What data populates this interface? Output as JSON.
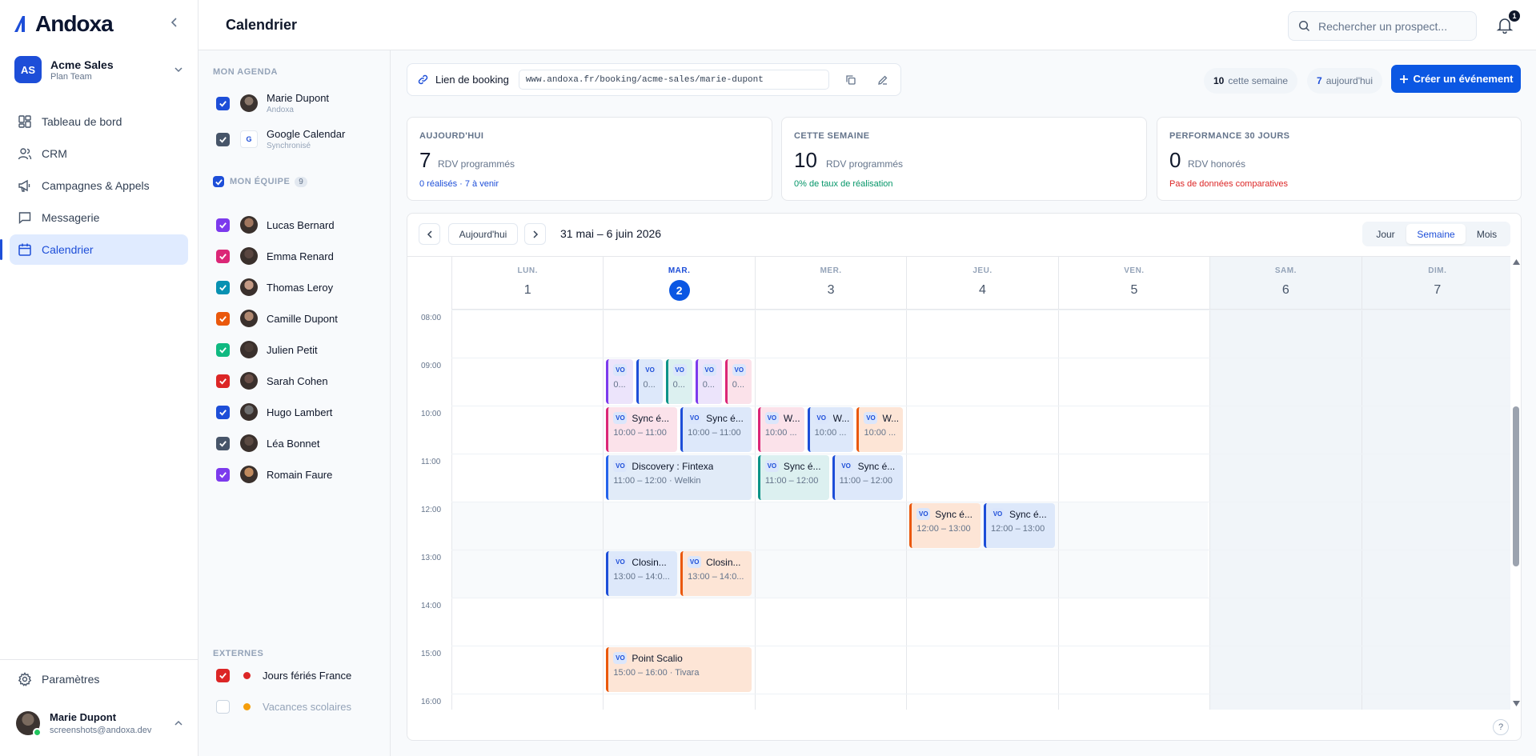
{
  "app": {
    "brand": "Andoxa",
    "workspace": {
      "initials": "AS",
      "name": "Acme Sales",
      "plan": "Plan Team"
    },
    "nav": [
      {
        "label": "Tableau de bord",
        "icon": "dashboard-icon"
      },
      {
        "label": "CRM",
        "icon": "users-icon"
      },
      {
        "label": "Campagnes & Appels",
        "icon": "megaphone-icon"
      },
      {
        "label": "Messagerie",
        "icon": "chat-icon"
      },
      {
        "label": "Calendrier",
        "icon": "calendar-icon",
        "active": true
      }
    ],
    "settings_label": "Paramètres",
    "user": {
      "name": "Marie Dupont",
      "email": "screenshots@andoxa.dev"
    }
  },
  "header": {
    "title": "Calendrier",
    "search_placeholder": "Rechercher un prospect...",
    "notifications": "1"
  },
  "agenda": {
    "my_agenda_title": "MON AGENDA",
    "my_agenda": [
      {
        "name": "Marie Dupont",
        "sub": "Andoxa",
        "color": "#1d4ed8"
      },
      {
        "name": "Google Calendar",
        "sub": "Synchronisé",
        "color": "#475569",
        "badge": "G"
      }
    ],
    "team_title": "MON ÉQUIPE",
    "team_count": "9",
    "team": [
      {
        "name": "Lucas Bernard",
        "color": "#7c3aed"
      },
      {
        "name": "Emma Renard",
        "color": "#db2777"
      },
      {
        "name": "Thomas Leroy",
        "color": "#0891b2"
      },
      {
        "name": "Camille Dupont",
        "color": "#ea580c"
      },
      {
        "name": "Julien Petit",
        "color": "#10b981"
      },
      {
        "name": "Sarah Cohen",
        "color": "#dc2626"
      },
      {
        "name": "Hugo Lambert",
        "color": "#1d4ed8"
      },
      {
        "name": "Léa Bonnet",
        "color": "#475569"
      },
      {
        "name": "Romain Faure",
        "color": "#7c3aed"
      }
    ],
    "external_title": "EXTERNES",
    "external": [
      {
        "name": "Jours fériés France",
        "checked": true,
        "dot": "#dc2626"
      },
      {
        "name": "Vacances scolaires",
        "checked": false,
        "dot": "#f59e0b"
      }
    ]
  },
  "booking": {
    "label": "Lien de booking",
    "url": "www.andoxa.fr/booking/acme-sales/marie-dupont"
  },
  "pills": {
    "week_count": "10",
    "week_label": "cette semaine",
    "today_count": "7",
    "today_label": "aujourd'hui"
  },
  "create_label": "Créer un événement",
  "stats": [
    {
      "label": "AUJOURD'HUI",
      "value": "7",
      "unit": "RDV programmés",
      "note": "0 réalisés · 7 à venir",
      "note_color": "#1d4ed8"
    },
    {
      "label": "CETTE SEMAINE",
      "value": "10",
      "unit": "RDV programmés",
      "note": "0% de taux de réalisation",
      "note_color": "#059669"
    },
    {
      "label": "PERFORMANCE 30 JOURS",
      "value": "0",
      "unit": "RDV honorés",
      "note": "Pas de données comparatives",
      "note_color": "#dc2626"
    }
  ],
  "calendar": {
    "today_label": "Aujourd'hui",
    "range": "31 mai – 6 juin 2026",
    "views": [
      "Jour",
      "Semaine",
      "Mois"
    ],
    "active_view": "Semaine",
    "days": [
      {
        "name": "LUN.",
        "num": "1"
      },
      {
        "name": "MAR.",
        "num": "2",
        "today": true
      },
      {
        "name": "MER.",
        "num": "3"
      },
      {
        "name": "JEU.",
        "num": "4"
      },
      {
        "name": "VEN.",
        "num": "5"
      },
      {
        "name": "SAM.",
        "num": "6",
        "weekend": true
      },
      {
        "name": "DIM.",
        "num": "7",
        "weekend": true
      }
    ],
    "hours": [
      "08:00",
      "09:00",
      "10:00",
      "11:00",
      "12:00",
      "13:00",
      "14:00",
      "15:00",
      "16:00"
    ],
    "tag": "VO",
    "events": [
      {
        "day": 1,
        "start": 9,
        "end": 10,
        "lane": 0,
        "lanes": 5,
        "title": "",
        "time": "0...",
        "color": "purple"
      },
      {
        "day": 1,
        "start": 9,
        "end": 10,
        "lane": 1,
        "lanes": 5,
        "title": "",
        "time": "0...",
        "color": "blue"
      },
      {
        "day": 1,
        "start": 9,
        "end": 10,
        "lane": 2,
        "lanes": 5,
        "title": "",
        "time": "0...",
        "color": "teal"
      },
      {
        "day": 1,
        "start": 9,
        "end": 10,
        "lane": 3,
        "lanes": 5,
        "title": "",
        "time": "0...",
        "color": "purple"
      },
      {
        "day": 1,
        "start": 9,
        "end": 10,
        "lane": 4,
        "lanes": 5,
        "title": "",
        "time": "0...",
        "color": "pink"
      },
      {
        "day": 1,
        "start": 10,
        "end": 11,
        "lane": 0,
        "lanes": 2,
        "title": "Sync é...",
        "time": "10:00 – 11:00",
        "color": "pink"
      },
      {
        "day": 1,
        "start": 10,
        "end": 11,
        "lane": 1,
        "lanes": 2,
        "title": "Sync é...",
        "time": "10:00 – 11:00",
        "color": "blue"
      },
      {
        "day": 1,
        "start": 11,
        "end": 12,
        "lane": 0,
        "lanes": 1,
        "title": "Discovery : Fintexa",
        "time": "11:00 – 12:00 · Welkin",
        "color": "lblue"
      },
      {
        "day": 1,
        "start": 13,
        "end": 14,
        "lane": 0,
        "lanes": 2,
        "title": "Closin...",
        "time": "13:00 – 14:0...",
        "color": "blue"
      },
      {
        "day": 1,
        "start": 13,
        "end": 14,
        "lane": 1,
        "lanes": 2,
        "title": "Closin...",
        "time": "13:00 – 14:0...",
        "color": "orange"
      },
      {
        "day": 1,
        "start": 15,
        "end": 16,
        "lane": 0,
        "lanes": 1,
        "title": "Point Scalio",
        "time": "15:00 – 16:00 · Tivara",
        "color": "orange"
      },
      {
        "day": 2,
        "start": 10,
        "end": 11,
        "lane": 0,
        "lanes": 3,
        "title": "W...",
        "time": "10:00 ...",
        "color": "pink"
      },
      {
        "day": 2,
        "start": 10,
        "end": 11,
        "lane": 1,
        "lanes": 3,
        "title": "W...",
        "time": "10:00 ...",
        "color": "blue"
      },
      {
        "day": 2,
        "start": 10,
        "end": 11,
        "lane": 2,
        "lanes": 3,
        "title": "W...",
        "time": "10:00 ...",
        "color": "orange"
      },
      {
        "day": 2,
        "start": 11,
        "end": 12,
        "lane": 0,
        "lanes": 2,
        "title": "Sync é...",
        "time": "11:00 – 12:00",
        "color": "teal"
      },
      {
        "day": 2,
        "start": 11,
        "end": 12,
        "lane": 1,
        "lanes": 2,
        "title": "Sync é...",
        "time": "11:00 – 12:00",
        "color": "blue"
      },
      {
        "day": 3,
        "start": 12,
        "end": 13,
        "lane": 0,
        "lanes": 2,
        "title": "Sync é...",
        "time": "12:00 – 13:00",
        "color": "orange"
      },
      {
        "day": 3,
        "start": 12,
        "end": 13,
        "lane": 1,
        "lanes": 2,
        "title": "Sync é...",
        "time": "12:00 – 13:00",
        "color": "blue"
      }
    ]
  }
}
